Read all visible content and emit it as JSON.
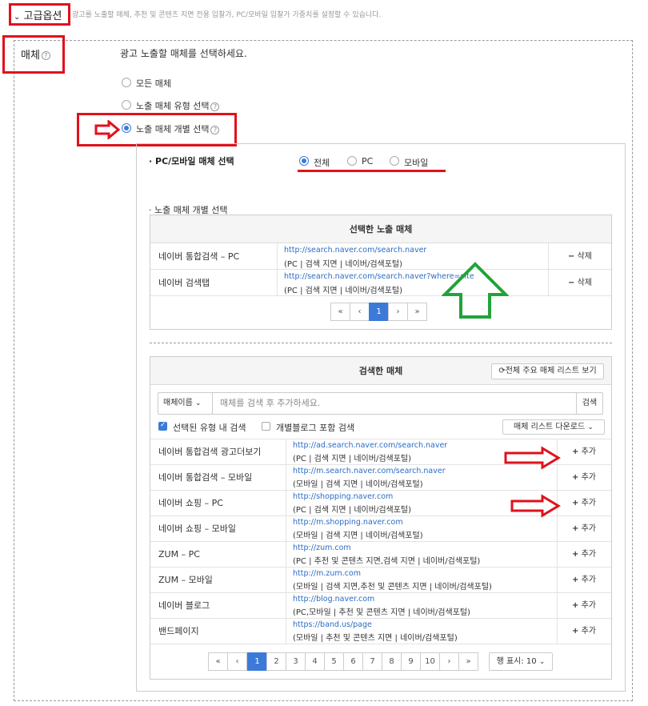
{
  "header": {
    "toggle_label": "고급옵션",
    "description": "광고를 노출할 매체, 추천 및 콘텐츠 지면 전용 입찰가, PC/모바일 입찰가 가중치를 설정할 수 있습니다."
  },
  "media": {
    "label": "매체",
    "help_icon": "?",
    "instruction": "광고 노출할 매체를 선택하세요.",
    "options": [
      {
        "label": "모든 매체",
        "selected": false
      },
      {
        "label": "노출 매체 유형 선택",
        "selected": false
      },
      {
        "label": "노출 매체 개별 선택",
        "selected": true
      }
    ]
  },
  "device": {
    "label": "PC/모바일 매체 선택",
    "options": [
      {
        "label": "전체",
        "selected": true
      },
      {
        "label": "PC",
        "selected": false
      },
      {
        "label": "모바일",
        "selected": false
      }
    ]
  },
  "individual": {
    "section_label": "노출 매체 개별 선택",
    "selected_panel": {
      "title": "선택한 노출 매체",
      "rows": [
        {
          "name": "네이버 통합검색 – PC",
          "url": "http://search.naver.com/search.naver",
          "detail": "(PC | 검색 지면 | 네이버/검색포털)",
          "action": "삭제"
        },
        {
          "name": "네이버 검색탭",
          "url": "http://search.naver.com/search.naver?where=site",
          "detail": "(PC | 검색 지면 | 네이버/검색포털)",
          "action": "삭제"
        }
      ],
      "pager": {
        "first": "«",
        "prev": "‹",
        "current": "1",
        "next": "›",
        "last": "»"
      }
    },
    "search_panel": {
      "title": "검색한 매체",
      "top_button": "전체 주요 매체 리스트 보기",
      "search_select": "매체이름",
      "search_placeholder": "매체를 검색 후 추가하세요.",
      "search_button": "검색",
      "filter_checked": "선택된 유형 내 검색",
      "filter_unchecked": "개별블로그 포함 검색",
      "download_button": "매체 리스트 다운로드",
      "rows": [
        {
          "name": "네이버 통합검색 광고더보기",
          "url": "http://ad.search.naver.com/search.naver",
          "detail": "(PC | 검색 지면 | 네이버/검색포털)",
          "action": "추가"
        },
        {
          "name": "네이버 통합검색 – 모바일",
          "url": "http://m.search.naver.com/search.naver",
          "detail": "(모바일 | 검색 지면 | 네이버/검색포털)",
          "action": "추가"
        },
        {
          "name": "네이버 쇼핑 – PC",
          "url": "http://shopping.naver.com",
          "detail": "(PC | 검색 지면 | 네이버/검색포털)",
          "action": "추가"
        },
        {
          "name": "네이버 쇼핑 – 모바일",
          "url": "http://m.shopping.naver.com",
          "detail": "(모바일 | 검색 지면 | 네이버/검색포털)",
          "action": "추가"
        },
        {
          "name": "ZUM – PC",
          "url": "http://zum.com",
          "detail": "(PC | 추천 및 콘텐츠 지면,검색 지면 | 네이버/검색포털)",
          "action": "추가"
        },
        {
          "name": "ZUM – 모바일",
          "url": "http://m.zum.com",
          "detail": "(모바일 | 검색 지면,추천 및 콘텐츠 지면 | 네이버/검색포털)",
          "action": "추가"
        },
        {
          "name": "네이버 블로그",
          "url": "http://blog.naver.com",
          "detail": "(PC,모바일 | 추천 및 콘텐츠 지면 | 네이버/검색포털)",
          "action": "추가"
        },
        {
          "name": "밴드페이지",
          "url": "https://band.us/page",
          "detail": "(모바일 | 추천 및 콘텐츠 지면 | 네이버/검색포털)",
          "action": "추가"
        }
      ],
      "pager": {
        "first": "«",
        "prev": "‹",
        "pages": [
          "1",
          "2",
          "3",
          "4",
          "5",
          "6",
          "7",
          "8",
          "9",
          "10"
        ],
        "current": "1",
        "next": "›",
        "last": "»"
      },
      "rows_per_page": "행 표시: 10"
    }
  },
  "colors": {
    "accent": "#3b7ad8",
    "annotation_red": "#e0111b",
    "annotation_green": "#22a33a",
    "link": "#2b6cc4"
  }
}
